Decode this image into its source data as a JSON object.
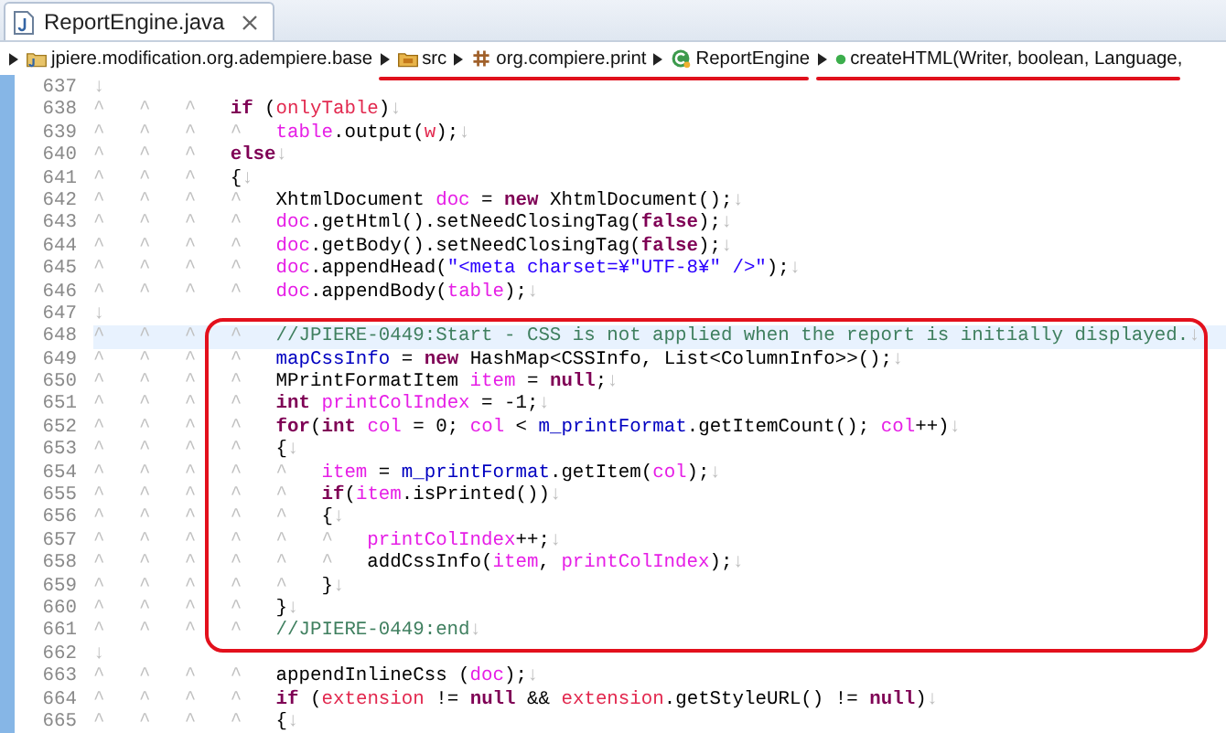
{
  "tabs": [
    {
      "label": "ReportEngine.java",
      "selected": true
    }
  ],
  "breadcrumb": [
    {
      "items": [
        {
          "kind": "project",
          "label": "jpiere.modification.org.adempiere.base"
        }
      ]
    },
    {
      "underlined": true,
      "items": [
        {
          "kind": "source-folder",
          "label": "src"
        },
        {
          "kind": "package",
          "label": "org.compiere.print"
        },
        {
          "kind": "class",
          "label": "ReportEngine"
        }
      ]
    },
    {
      "underlined": true,
      "items": [
        {
          "kind": "method",
          "label": "createHTML(Writer, boolean, Language,"
        }
      ]
    }
  ],
  "editor": {
    "blocks": [
      {
        "lines": [
          {
            "number": "637",
            "current": false,
            "tokens": [
              {
                "kind": "ws",
                "text": "↓"
              }
            ]
          },
          {
            "number": "638",
            "current": false,
            "tokens": [
              {
                "kind": "ws",
                "text": "^\t^\t^\t"
              },
              {
                "kind": "keyword",
                "text": "if"
              },
              {
                "kind": "plain",
                "text": " ("
              },
              {
                "kind": "param",
                "text": "onlyTable"
              },
              {
                "kind": "plain",
                "text": ")"
              },
              {
                "kind": "ws",
                "text": "↓"
              }
            ]
          },
          {
            "number": "639",
            "current": false,
            "tokens": [
              {
                "kind": "ws",
                "text": "^\t^\t^\t^\t"
              },
              {
                "kind": "local",
                "text": "table"
              },
              {
                "kind": "plain",
                "text": ".output("
              },
              {
                "kind": "param",
                "text": "w"
              },
              {
                "kind": "plain",
                "text": ");"
              },
              {
                "kind": "ws",
                "text": "↓"
              }
            ]
          },
          {
            "number": "640",
            "current": false,
            "tokens": [
              {
                "kind": "ws",
                "text": "^\t^\t^\t"
              },
              {
                "kind": "keyword",
                "text": "else"
              },
              {
                "kind": "ws",
                "text": "↓"
              }
            ]
          },
          {
            "number": "641",
            "current": false,
            "tokens": [
              {
                "kind": "ws",
                "text": "^\t^\t^\t"
              },
              {
                "kind": "plain",
                "text": "{"
              },
              {
                "kind": "ws",
                "text": "↓"
              }
            ]
          },
          {
            "number": "642",
            "current": false,
            "tokens": [
              {
                "kind": "ws",
                "text": "^\t^\t^\t^\t"
              },
              {
                "kind": "plain",
                "text": "XhtmlDocument "
              },
              {
                "kind": "local",
                "text": "doc"
              },
              {
                "kind": "plain",
                "text": " = "
              },
              {
                "kind": "keyword",
                "text": "new"
              },
              {
                "kind": "plain",
                "text": " XhtmlDocument();"
              },
              {
                "kind": "ws",
                "text": "↓"
              }
            ]
          },
          {
            "number": "643",
            "current": false,
            "tokens": [
              {
                "kind": "ws",
                "text": "^\t^\t^\t^\t"
              },
              {
                "kind": "local",
                "text": "doc"
              },
              {
                "kind": "plain",
                "text": ".getHtml().setNeedClosingTag("
              },
              {
                "kind": "keyword",
                "text": "false"
              },
              {
                "kind": "plain",
                "text": ");"
              },
              {
                "kind": "ws",
                "text": "↓"
              }
            ]
          },
          {
            "number": "644",
            "current": false,
            "tokens": [
              {
                "kind": "ws",
                "text": "^\t^\t^\t^\t"
              },
              {
                "kind": "local",
                "text": "doc"
              },
              {
                "kind": "plain",
                "text": ".getBody().setNeedClosingTag("
              },
              {
                "kind": "keyword",
                "text": "false"
              },
              {
                "kind": "plain",
                "text": ");"
              },
              {
                "kind": "ws",
                "text": "↓"
              }
            ]
          },
          {
            "number": "645",
            "current": false,
            "tokens": [
              {
                "kind": "ws",
                "text": "^\t^\t^\t^\t"
              },
              {
                "kind": "local",
                "text": "doc"
              },
              {
                "kind": "plain",
                "text": ".appendHead("
              },
              {
                "kind": "string",
                "text": "\"<meta charset=¥\"UTF-8¥\" />\""
              },
              {
                "kind": "plain",
                "text": ");"
              },
              {
                "kind": "ws",
                "text": "↓"
              }
            ]
          },
          {
            "number": "646",
            "current": false,
            "tokens": [
              {
                "kind": "ws",
                "text": "^\t^\t^\t^\t"
              },
              {
                "kind": "local",
                "text": "doc"
              },
              {
                "kind": "plain",
                "text": ".appendBody("
              },
              {
                "kind": "local",
                "text": "table"
              },
              {
                "kind": "plain",
                "text": ");"
              },
              {
                "kind": "ws",
                "text": "↓"
              }
            ]
          },
          {
            "number": "647",
            "current": false,
            "tokens": [
              {
                "kind": "ws",
                "text": "↓"
              }
            ]
          }
        ]
      },
      {
        "framed": true,
        "lines": [
          {
            "number": "648",
            "current": true,
            "tokens": [
              {
                "kind": "ws",
                "text": "^\t^\t^\t^\t"
              },
              {
                "kind": "comment",
                "text": "//JPIERE-0449:Start - CSS is not applied when the report is initially displayed."
              },
              {
                "kind": "ws",
                "text": "↓"
              }
            ]
          },
          {
            "number": "649",
            "current": false,
            "tokens": [
              {
                "kind": "ws",
                "text": "^\t^\t^\t^\t"
              },
              {
                "kind": "field",
                "text": "mapCssInfo"
              },
              {
                "kind": "plain",
                "text": " = "
              },
              {
                "kind": "keyword",
                "text": "new"
              },
              {
                "kind": "plain",
                "text": " HashMap<CSSInfo, List<ColumnInfo>>();"
              },
              {
                "kind": "ws",
                "text": "↓"
              }
            ]
          },
          {
            "number": "650",
            "current": false,
            "tokens": [
              {
                "kind": "ws",
                "text": "^\t^\t^\t^\t"
              },
              {
                "kind": "plain",
                "text": "MPrintFormatItem "
              },
              {
                "kind": "local",
                "text": "item"
              },
              {
                "kind": "plain",
                "text": " = "
              },
              {
                "kind": "keyword",
                "text": "null"
              },
              {
                "kind": "plain",
                "text": ";"
              },
              {
                "kind": "ws",
                "text": "↓"
              }
            ]
          },
          {
            "number": "651",
            "current": false,
            "tokens": [
              {
                "kind": "ws",
                "text": "^\t^\t^\t^\t"
              },
              {
                "kind": "keyword",
                "text": "int"
              },
              {
                "kind": "local",
                "text": " printColIndex"
              },
              {
                "kind": "plain",
                "text": " = -1;"
              },
              {
                "kind": "ws",
                "text": "↓"
              }
            ]
          },
          {
            "number": "652",
            "current": false,
            "tokens": [
              {
                "kind": "ws",
                "text": "^\t^\t^\t^\t"
              },
              {
                "kind": "keyword",
                "text": "for"
              },
              {
                "kind": "plain",
                "text": "("
              },
              {
                "kind": "keyword",
                "text": "int"
              },
              {
                "kind": "local",
                "text": " col"
              },
              {
                "kind": "plain",
                "text": " = 0; "
              },
              {
                "kind": "local",
                "text": "col"
              },
              {
                "kind": "plain",
                "text": " < "
              },
              {
                "kind": "field",
                "text": "m_printFormat"
              },
              {
                "kind": "plain",
                "text": ".getItemCount(); "
              },
              {
                "kind": "local",
                "text": "col"
              },
              {
                "kind": "plain",
                "text": "++)"
              },
              {
                "kind": "ws",
                "text": "↓"
              }
            ]
          },
          {
            "number": "653",
            "current": false,
            "tokens": [
              {
                "kind": "ws",
                "text": "^\t^\t^\t^\t"
              },
              {
                "kind": "plain",
                "text": "{"
              },
              {
                "kind": "ws",
                "text": "↓"
              }
            ]
          },
          {
            "number": "654",
            "current": false,
            "tokens": [
              {
                "kind": "ws",
                "text": "^\t^\t^\t^\t^\t"
              },
              {
                "kind": "local",
                "text": "item"
              },
              {
                "kind": "plain",
                "text": " = "
              },
              {
                "kind": "field",
                "text": "m_printFormat"
              },
              {
                "kind": "plain",
                "text": ".getItem("
              },
              {
                "kind": "local",
                "text": "col"
              },
              {
                "kind": "plain",
                "text": ");"
              },
              {
                "kind": "ws",
                "text": "↓"
              }
            ]
          },
          {
            "number": "655",
            "current": false,
            "tokens": [
              {
                "kind": "ws",
                "text": "^\t^\t^\t^\t^\t"
              },
              {
                "kind": "keyword",
                "text": "if"
              },
              {
                "kind": "plain",
                "text": "("
              },
              {
                "kind": "local",
                "text": "item"
              },
              {
                "kind": "plain",
                "text": ".isPrinted())"
              },
              {
                "kind": "ws",
                "text": "↓"
              }
            ]
          },
          {
            "number": "656",
            "current": false,
            "tokens": [
              {
                "kind": "ws",
                "text": "^\t^\t^\t^\t^\t"
              },
              {
                "kind": "plain",
                "text": "{"
              },
              {
                "kind": "ws",
                "text": "↓"
              }
            ]
          },
          {
            "number": "657",
            "current": false,
            "tokens": [
              {
                "kind": "ws",
                "text": "^\t^\t^\t^\t^\t^\t"
              },
              {
                "kind": "local",
                "text": "printColIndex"
              },
              {
                "kind": "plain",
                "text": "++;"
              },
              {
                "kind": "ws",
                "text": "↓"
              }
            ]
          },
          {
            "number": "658",
            "current": false,
            "tokens": [
              {
                "kind": "ws",
                "text": "^\t^\t^\t^\t^\t^\t"
              },
              {
                "kind": "plain",
                "text": "addCssInfo("
              },
              {
                "kind": "local",
                "text": "item"
              },
              {
                "kind": "plain",
                "text": ", "
              },
              {
                "kind": "local",
                "text": "printColIndex"
              },
              {
                "kind": "plain",
                "text": ");"
              },
              {
                "kind": "ws",
                "text": "↓"
              }
            ]
          },
          {
            "number": "659",
            "current": false,
            "tokens": [
              {
                "kind": "ws",
                "text": "^\t^\t^\t^\t^\t"
              },
              {
                "kind": "plain",
                "text": "}"
              },
              {
                "kind": "ws",
                "text": "↓"
              }
            ]
          },
          {
            "number": "660",
            "current": false,
            "tokens": [
              {
                "kind": "ws",
                "text": "^\t^\t^\t^\t"
              },
              {
                "kind": "plain",
                "text": "}"
              },
              {
                "kind": "ws",
                "text": "↓"
              }
            ]
          },
          {
            "number": "661",
            "current": false,
            "tokens": [
              {
                "kind": "ws",
                "text": "^\t^\t^\t^\t"
              },
              {
                "kind": "comment",
                "text": "//JPIERE-0449:end"
              },
              {
                "kind": "ws",
                "text": "↓"
              }
            ]
          }
        ]
      },
      {
        "lines": [
          {
            "number": "662",
            "current": false,
            "tokens": [
              {
                "kind": "ws",
                "text": "↓"
              }
            ]
          },
          {
            "number": "663",
            "current": false,
            "tokens": [
              {
                "kind": "ws",
                "text": "^\t^\t^\t^\t"
              },
              {
                "kind": "plain",
                "text": "appendInlineCss ("
              },
              {
                "kind": "local",
                "text": "doc"
              },
              {
                "kind": "plain",
                "text": ");"
              },
              {
                "kind": "ws",
                "text": "↓"
              }
            ]
          },
          {
            "number": "664",
            "current": false,
            "tokens": [
              {
                "kind": "ws",
                "text": "^\t^\t^\t^\t"
              },
              {
                "kind": "keyword",
                "text": "if"
              },
              {
                "kind": "plain",
                "text": " ("
              },
              {
                "kind": "param",
                "text": "extension"
              },
              {
                "kind": "plain",
                "text": " != "
              },
              {
                "kind": "keyword",
                "text": "null"
              },
              {
                "kind": "plain",
                "text": " && "
              },
              {
                "kind": "param",
                "text": "extension"
              },
              {
                "kind": "plain",
                "text": ".getStyleURL() != "
              },
              {
                "kind": "keyword",
                "text": "null"
              },
              {
                "kind": "plain",
                "text": ")"
              },
              {
                "kind": "ws",
                "text": "↓"
              }
            ]
          },
          {
            "number": "665",
            "current": false,
            "tokens": [
              {
                "kind": "ws",
                "text": "^\t^\t^\t^\t"
              },
              {
                "kind": "plain",
                "text": "{"
              },
              {
                "kind": "ws",
                "text": "↓"
              }
            ]
          }
        ]
      }
    ]
  }
}
